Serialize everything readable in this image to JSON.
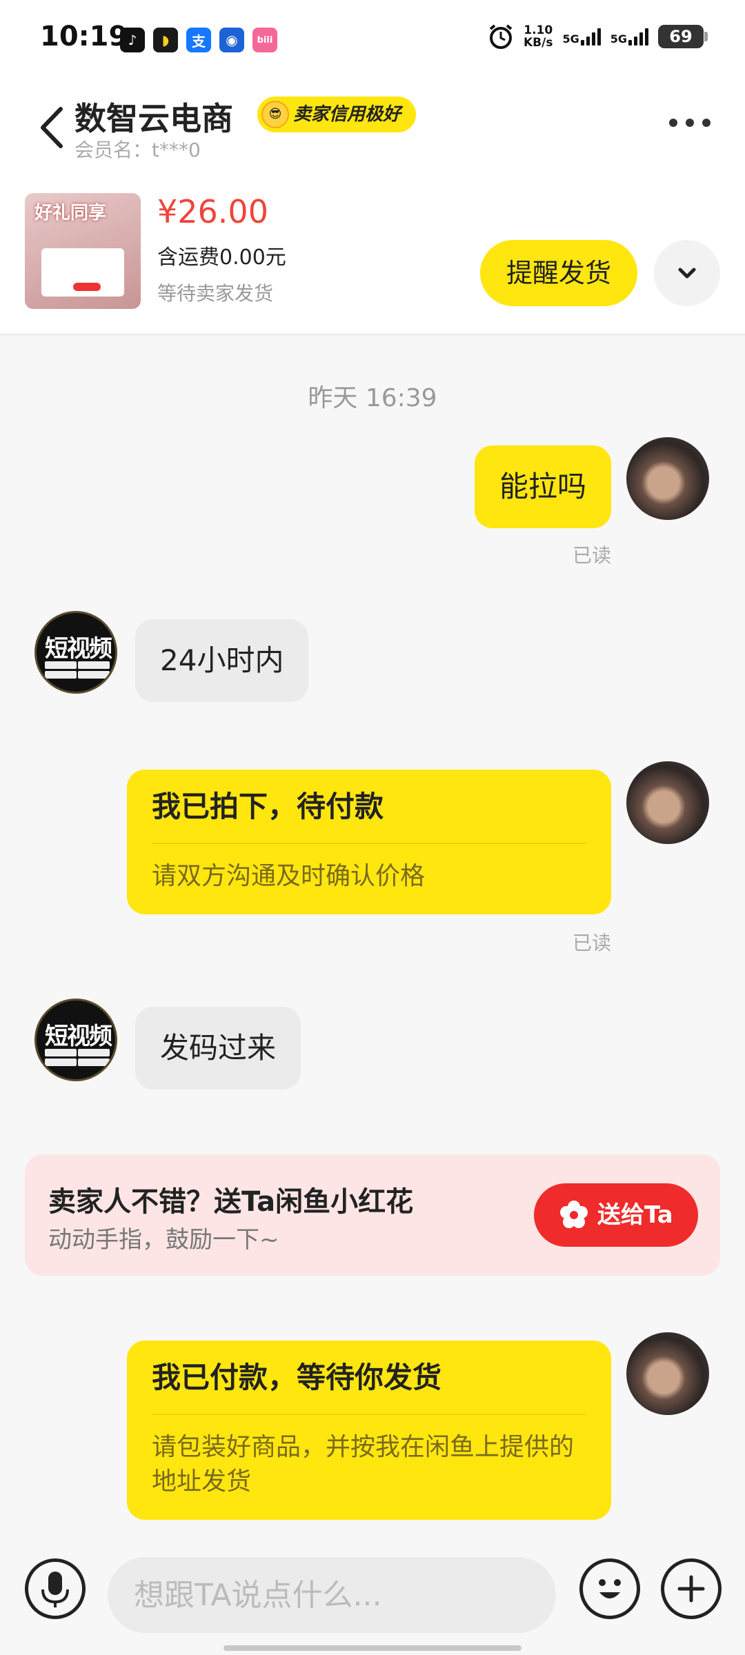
{
  "status_bar": {
    "time": "10:19",
    "speed_value": "1.10",
    "speed_unit": "KB/s",
    "net1": "5G",
    "net2": "5G",
    "battery": "69"
  },
  "header": {
    "seller_name": "数智云电商",
    "credit_badge": "卖家信用极好",
    "member": "会员名：t***0"
  },
  "product": {
    "thumb_text": "好礼同享",
    "price": "¥26.00",
    "shipping": "含运费0.00元",
    "status": "等待卖家发货",
    "remind_button": "提醒发货"
  },
  "chat": {
    "time_separator": "昨天 16:39",
    "seller_avatar_text": "短视频",
    "messages": [
      {
        "from": "me",
        "text": "能拉吗",
        "read": "已读"
      },
      {
        "from": "seller",
        "text": "24小时内"
      },
      {
        "from": "me",
        "card_title": "我已拍下，待付款",
        "card_body": "请双方沟通及时确认价格",
        "read": "已读"
      },
      {
        "from": "seller",
        "text": "发码过来"
      },
      {
        "from": "me",
        "card_title": "我已付款，等待你发货",
        "card_body": "请包装好商品，并按我在闲鱼上提供的地址发货"
      }
    ],
    "promo": {
      "title": "卖家人不错？送Ta闲鱼小红花",
      "subtitle": "动动手指，鼓励一下~",
      "button": "送给Ta"
    }
  },
  "input": {
    "placeholder": "想跟TA说点什么..."
  },
  "colors": {
    "accent_yellow": "#ffe60f",
    "price_red": "#f0443c",
    "promo_red": "#ef2b2b"
  }
}
